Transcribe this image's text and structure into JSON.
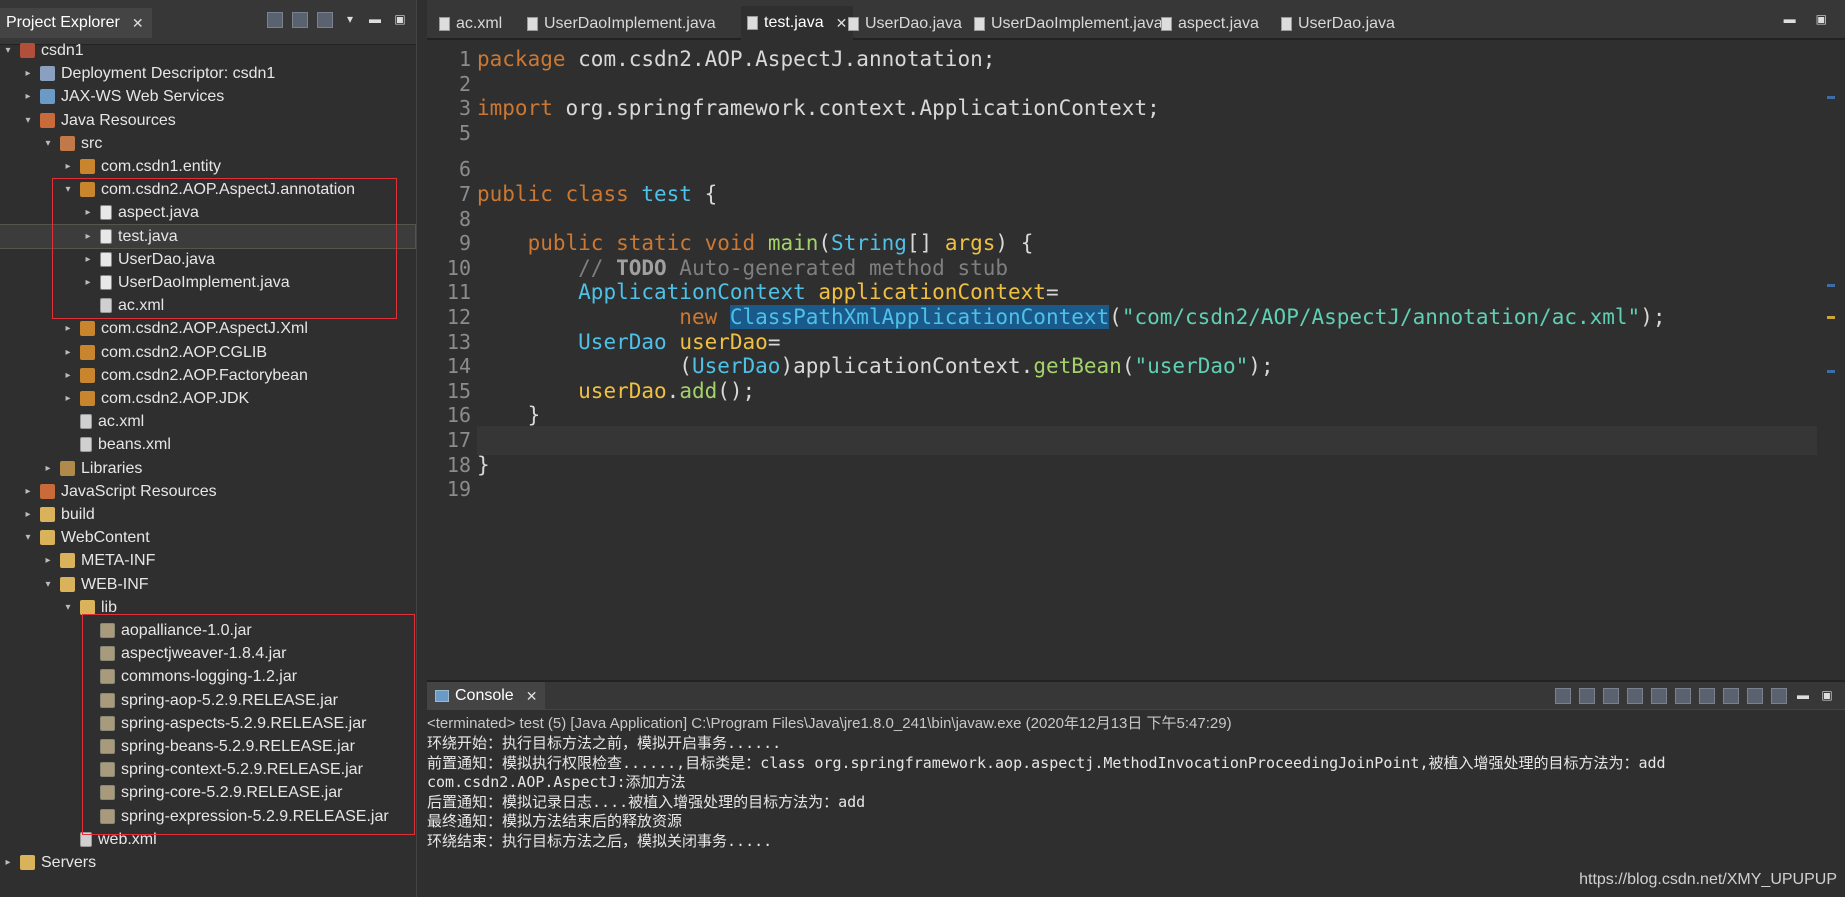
{
  "explorer": {
    "tab_label": "Project Explorer",
    "close_symbol": "✕",
    "tree": [
      {
        "label": "csdn1",
        "depth": 0,
        "twisty": "▾",
        "icon": "project-icon"
      },
      {
        "label": "Deployment Descriptor: csdn1",
        "depth": 1,
        "twisty": "▸",
        "icon": "descriptor-icon"
      },
      {
        "label": "JAX-WS Web Services",
        "depth": 1,
        "twisty": "▸",
        "icon": "web-services-icon"
      },
      {
        "label": "Java Resources",
        "depth": 1,
        "twisty": "▾",
        "icon": "java-resources-icon"
      },
      {
        "label": "src",
        "depth": 2,
        "twisty": "▾",
        "icon": "source-folder-icon"
      },
      {
        "label": "com.csdn1.entity",
        "depth": 3,
        "twisty": "▸",
        "icon": "package-icon"
      },
      {
        "label": "com.csdn2.AOP.AspectJ.annotation",
        "depth": 3,
        "twisty": "▾",
        "icon": "package-icon"
      },
      {
        "label": "aspect.java",
        "depth": 4,
        "twisty": "▸",
        "icon": "java-file-icon"
      },
      {
        "label": "test.java",
        "depth": 4,
        "twisty": "▸",
        "icon": "java-file-icon",
        "selected": true
      },
      {
        "label": "UserDao.java",
        "depth": 4,
        "twisty": "▸",
        "icon": "java-file-icon"
      },
      {
        "label": "UserDaoImplement.java",
        "depth": 4,
        "twisty": "▸",
        "icon": "java-file-icon"
      },
      {
        "label": "ac.xml",
        "depth": 4,
        "twisty": "",
        "icon": "xml-file-icon"
      },
      {
        "label": "com.csdn2.AOP.AspectJ.Xml",
        "depth": 3,
        "twisty": "▸",
        "icon": "package-icon"
      },
      {
        "label": "com.csdn2.AOP.CGLIB",
        "depth": 3,
        "twisty": "▸",
        "icon": "package-icon"
      },
      {
        "label": "com.csdn2.AOP.Factorybean",
        "depth": 3,
        "twisty": "▸",
        "icon": "package-icon"
      },
      {
        "label": "com.csdn2.AOP.JDK",
        "depth": 3,
        "twisty": "▸",
        "icon": "package-icon"
      },
      {
        "label": "ac.xml",
        "depth": 3,
        "twisty": "",
        "icon": "xml-file-icon"
      },
      {
        "label": "beans.xml",
        "depth": 3,
        "twisty": "",
        "icon": "xml-file-icon"
      },
      {
        "label": "Libraries",
        "depth": 2,
        "twisty": "▸",
        "icon": "library-icon"
      },
      {
        "label": "JavaScript Resources",
        "depth": 1,
        "twisty": "▸",
        "icon": "js-resources-icon"
      },
      {
        "label": "build",
        "depth": 1,
        "twisty": "▸",
        "icon": "folder-icon"
      },
      {
        "label": "WebContent",
        "depth": 1,
        "twisty": "▾",
        "icon": "folder-icon"
      },
      {
        "label": "META-INF",
        "depth": 2,
        "twisty": "▸",
        "icon": "folder-icon"
      },
      {
        "label": "WEB-INF",
        "depth": 2,
        "twisty": "▾",
        "icon": "folder-icon"
      },
      {
        "label": "lib",
        "depth": 3,
        "twisty": "▾",
        "icon": "folder-icon"
      },
      {
        "label": "aopalliance-1.0.jar",
        "depth": 4,
        "twisty": "",
        "icon": "jar-icon"
      },
      {
        "label": "aspectjweaver-1.8.4.jar",
        "depth": 4,
        "twisty": "",
        "icon": "jar-icon"
      },
      {
        "label": "commons-logging-1.2.jar",
        "depth": 4,
        "twisty": "",
        "icon": "jar-icon"
      },
      {
        "label": "spring-aop-5.2.9.RELEASE.jar",
        "depth": 4,
        "twisty": "",
        "icon": "jar-icon"
      },
      {
        "label": "spring-aspects-5.2.9.RELEASE.jar",
        "depth": 4,
        "twisty": "",
        "icon": "jar-icon"
      },
      {
        "label": "spring-beans-5.2.9.RELEASE.jar",
        "depth": 4,
        "twisty": "",
        "icon": "jar-icon"
      },
      {
        "label": "spring-context-5.2.9.RELEASE.jar",
        "depth": 4,
        "twisty": "",
        "icon": "jar-icon"
      },
      {
        "label": "spring-core-5.2.9.RELEASE.jar",
        "depth": 4,
        "twisty": "",
        "icon": "jar-icon"
      },
      {
        "label": "spring-expression-5.2.9.RELEASE.jar",
        "depth": 4,
        "twisty": "",
        "icon": "jar-icon"
      },
      {
        "label": "web.xml",
        "depth": 3,
        "twisty": "",
        "icon": "xml-file-icon"
      },
      {
        "label": "Servers",
        "depth": 0,
        "twisty": "▸",
        "icon": "servers-folder-icon"
      }
    ]
  },
  "editor": {
    "tabs": [
      {
        "label": "ac.xml",
        "active": false
      },
      {
        "label": "UserDaoImplement.java",
        "active": false
      },
      {
        "label": "test.java",
        "active": true
      },
      {
        "label": "UserDao.java",
        "active": false
      },
      {
        "label": "UserDaoImplement.java",
        "active": false
      },
      {
        "label": "aspect.java",
        "active": false
      },
      {
        "label": "UserDao.java",
        "active": false
      }
    ],
    "line_numbers": [
      "1",
      "2",
      "3",
      "5",
      "6",
      "7",
      "8",
      "9",
      "10",
      "11",
      "12",
      "13",
      "14",
      "15",
      "16",
      "17",
      "18",
      "19"
    ],
    "code": [
      [
        {
          "t": "package ",
          "c": "kw"
        },
        {
          "t": "com.csdn2.AOP.AspectJ.annotation;",
          "c": ""
        }
      ],
      [],
      [
        {
          "t": "import ",
          "c": "kw"
        },
        {
          "t": "org.springframework.context.ApplicationContext;",
          "c": ""
        }
      ],
      [],
      [],
      [
        {
          "t": "public ",
          "c": "kw"
        },
        {
          "t": "class ",
          "c": "kw"
        },
        {
          "t": "test",
          "c": "cls"
        },
        {
          "t": " {",
          "c": ""
        }
      ],
      [],
      [
        {
          "t": "    public ",
          "c": "kw"
        },
        {
          "t": "static ",
          "c": "kw"
        },
        {
          "t": "void ",
          "c": "kw"
        },
        {
          "t": "main",
          "c": "mth"
        },
        {
          "t": "(",
          "c": ""
        },
        {
          "t": "String",
          "c": "cls"
        },
        {
          "t": "[] ",
          "c": ""
        },
        {
          "t": "args",
          "c": "var"
        },
        {
          "t": ") {",
          "c": ""
        }
      ],
      [
        {
          "t": "        // ",
          "c": "cmt"
        },
        {
          "t": "TODO",
          "c": "todo"
        },
        {
          "t": " Auto-generated method stub",
          "c": "cmt"
        }
      ],
      [
        {
          "t": "        ",
          "c": ""
        },
        {
          "t": "ApplicationContext ",
          "c": "cls"
        },
        {
          "t": "applicationContext",
          "c": "var"
        },
        {
          "t": "=",
          "c": ""
        }
      ],
      [
        {
          "t": "                ",
          "c": ""
        },
        {
          "t": "new ",
          "c": "kw"
        },
        {
          "t": "ClassPathXmlApplicationContext",
          "c": "cls hl"
        },
        {
          "t": "(",
          "c": ""
        },
        {
          "t": "\"com/csdn2/AOP/AspectJ/annotation/ac.xml\"",
          "c": "str"
        },
        {
          "t": ");",
          "c": ""
        }
      ],
      [
        {
          "t": "        ",
          "c": ""
        },
        {
          "t": "UserDao ",
          "c": "cls"
        },
        {
          "t": "userDao",
          "c": "var"
        },
        {
          "t": "=",
          "c": ""
        }
      ],
      [
        {
          "t": "                (",
          "c": ""
        },
        {
          "t": "UserDao",
          "c": "cls"
        },
        {
          "t": ")applicationContext.",
          "c": ""
        },
        {
          "t": "getBean",
          "c": "mth"
        },
        {
          "t": "(",
          "c": ""
        },
        {
          "t": "\"userDao\"",
          "c": "str"
        },
        {
          "t": ");",
          "c": ""
        }
      ],
      [
        {
          "t": "        ",
          "c": ""
        },
        {
          "t": "userDao",
          "c": "var"
        },
        {
          "t": ".",
          "c": ""
        },
        {
          "t": "add",
          "c": "mth"
        },
        {
          "t": "();",
          "c": ""
        }
      ],
      [
        {
          "t": "    }",
          "c": ""
        }
      ],
      [],
      [
        {
          "t": "}",
          "c": ""
        }
      ],
      []
    ]
  },
  "console": {
    "tab_label": "Console",
    "close_symbol": "✕",
    "status": "<terminated> test (5) [Java Application] C:\\Program Files\\Java\\jre1.8.0_241\\bin\\javaw.exe (2020年12月13日 下午5:47:29)",
    "lines": [
      "环绕开始：执行目标方法之前，模拟开启事务......",
      "前置通知：模拟执行权限检查......,目标类是：class org.springframework.aop.aspectj.MethodInvocationProceedingJoinPoint,被植入增强处理的目标方法为：add",
      "com.csdn2.AOP.AspectJ:添加方法",
      "后置通知：模拟记录日志....被植入增强处理的目标方法为：add",
      "最终通知：模拟方法结束后的释放资源",
      "环绕结束：执行目标方法之后，模拟关闭事务....."
    ]
  },
  "watermark": "https://blog.csdn.net/XMY_UPUPUP"
}
